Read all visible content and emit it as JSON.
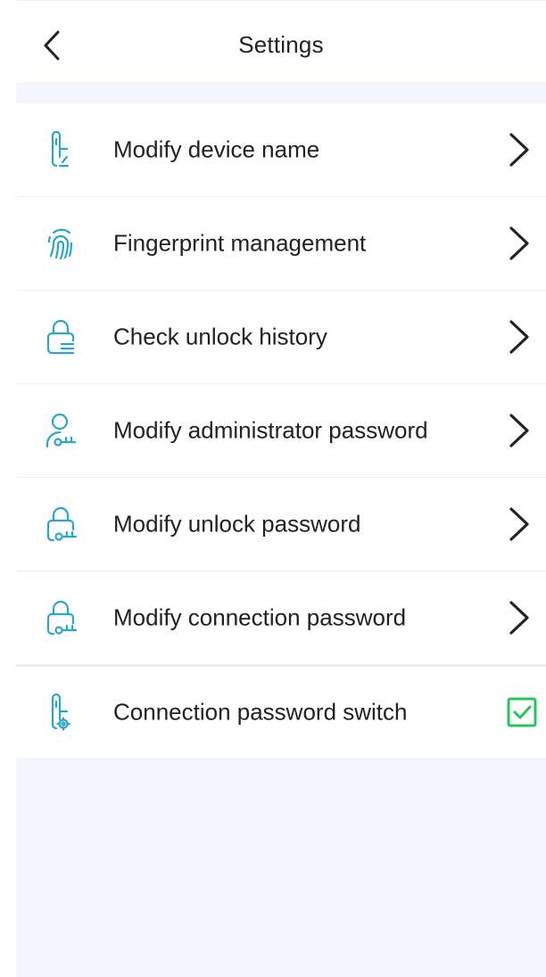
{
  "header": {
    "title": "Settings",
    "back_icon": "chevron-left-icon"
  },
  "colors": {
    "accent": "#2aa6c9",
    "check": "#22c55e",
    "page_bg": "#f3f7fb"
  },
  "settings": {
    "items": [
      {
        "label": "Modify device name",
        "icon": "lock-edit-icon",
        "action": "chevron-right-icon"
      },
      {
        "label": "Fingerprint management",
        "icon": "fingerprint-icon",
        "action": "chevron-right-icon"
      },
      {
        "label": "Check unlock history",
        "icon": "lock-list-icon",
        "action": "chevron-right-icon"
      },
      {
        "label": "Modify administrator password",
        "icon": "user-key-icon",
        "action": "chevron-right-icon"
      },
      {
        "label": "Modify unlock password",
        "icon": "lock-key-icon",
        "action": "chevron-right-icon"
      },
      {
        "label": "Modify connection password",
        "icon": "lock-key-icon",
        "action": "chevron-right-icon"
      },
      {
        "label": "Connection password switch",
        "icon": "lock-gear-icon",
        "action": "checkbox",
        "checked": true
      }
    ]
  }
}
